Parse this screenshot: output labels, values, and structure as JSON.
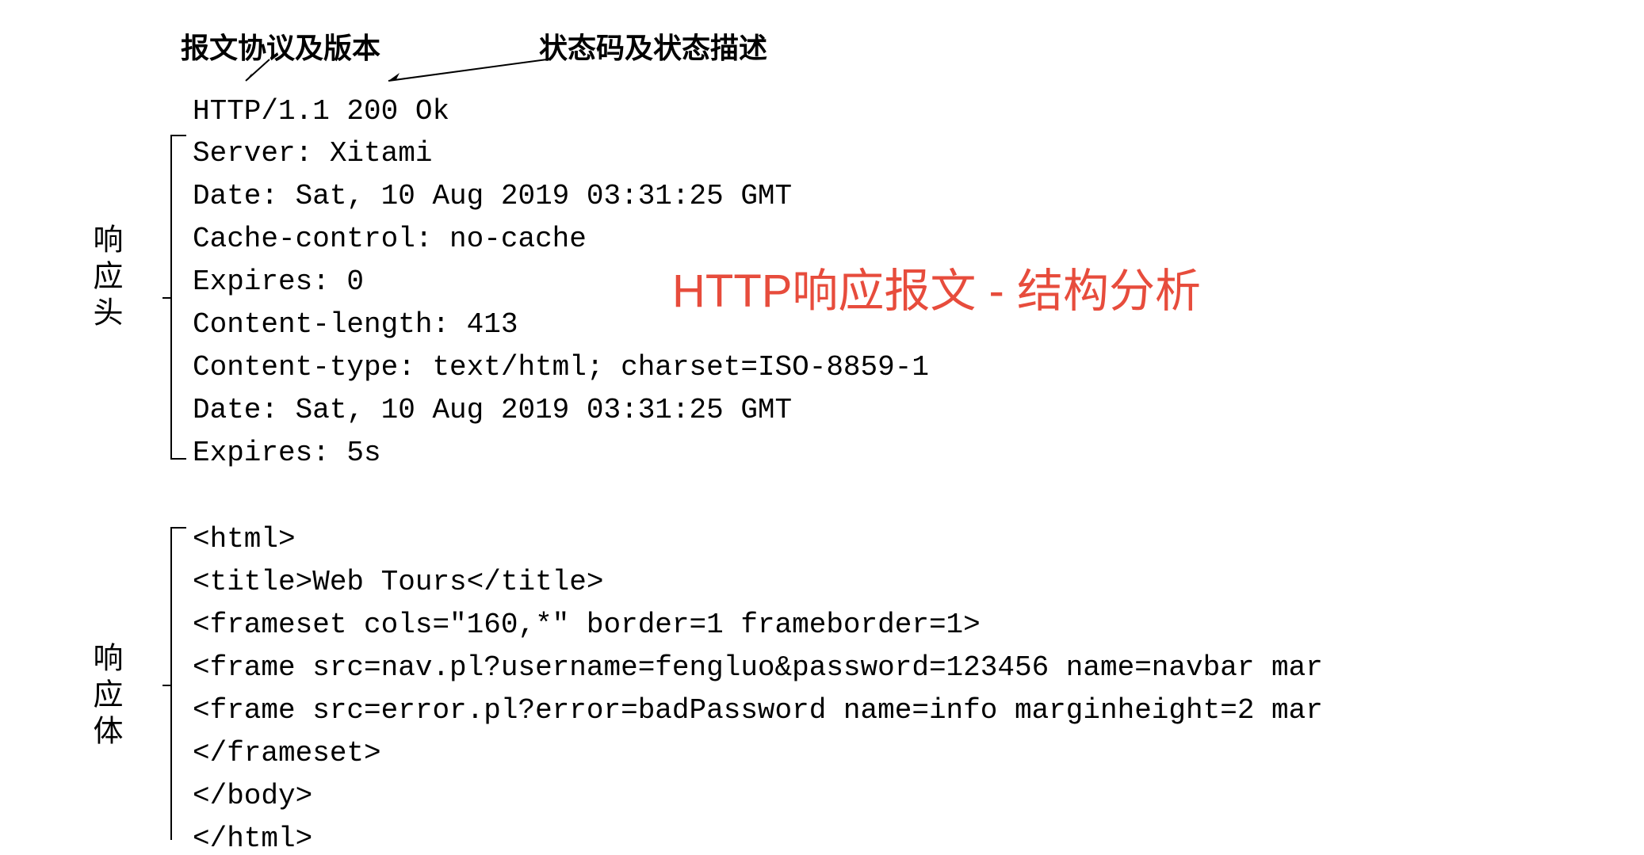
{
  "labels": {
    "protocol_version": "报文协议及版本",
    "status_code_desc": "状态码及状态描述",
    "response_header": "响应头",
    "response_body": "响应体"
  },
  "title": "HTTP响应报文 - 结构分析",
  "status_line": "HTTP/1.1 200 Ok",
  "headers": {
    "server": "Server: Xitami",
    "date1": "Date: Sat, 10 Aug 2019 03:31:25 GMT",
    "cache": "Cache-control: no-cache",
    "expires1": "Expires: 0",
    "content_length": "Content-length: 413",
    "content_type": "Content-type: text/html; charset=ISO-8859-1",
    "date2": "Date: Sat, 10 Aug 2019 03:31:25 GMT",
    "expires2": "Expires: 5s"
  },
  "body": {
    "line1": "<html>",
    "line2": "<title>Web Tours</title>",
    "line3": "<frameset cols=\"160,*\" border=1 frameborder=1>",
    "line4": "<frame src=nav.pl?username=fengluo&password=123456 name=navbar mar",
    "line5": "<frame src=error.pl?error=badPassword name=info marginheight=2 mar",
    "line6": "</frameset>",
    "line7": "</body>",
    "line8": "</html>"
  }
}
